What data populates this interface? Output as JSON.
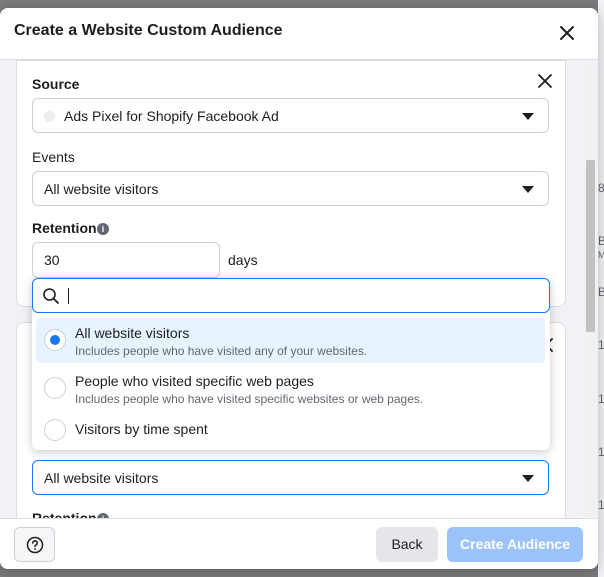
{
  "dialog": {
    "title": "Create a Website Custom Audience"
  },
  "source": {
    "label": "Source",
    "value": "Ads Pixel for Shopify Facebook Ad"
  },
  "events": {
    "label": "Events",
    "value": "All website visitors"
  },
  "retention": {
    "label": "Retention",
    "value": "30",
    "unit": "days"
  },
  "dropdown": {
    "search_value": "",
    "options": [
      {
        "title": "All website visitors",
        "description": "Includes people who have visited any of your websites.",
        "selected": true
      },
      {
        "title": "People who visited specific web pages",
        "description": "Includes people who have visited specific websites or web pages.",
        "selected": false
      },
      {
        "title": "Visitors by time spent",
        "description": "",
        "selected": false
      }
    ]
  },
  "second_rule": {
    "events_value": "All website visitors",
    "retention_label": "Retention"
  },
  "footer": {
    "help_icon": "question-circle-icon",
    "back_label": "Back",
    "create_label": "Create Audience"
  },
  "background": {
    "peek_chars": [
      "8",
      "B",
      "M",
      "B",
      "1(",
      "1",
      "1",
      "1"
    ]
  },
  "colors": {
    "accent": "#1877f2",
    "selected_bg": "#e7f3ff",
    "create_disabled": "#9cc3f9"
  }
}
